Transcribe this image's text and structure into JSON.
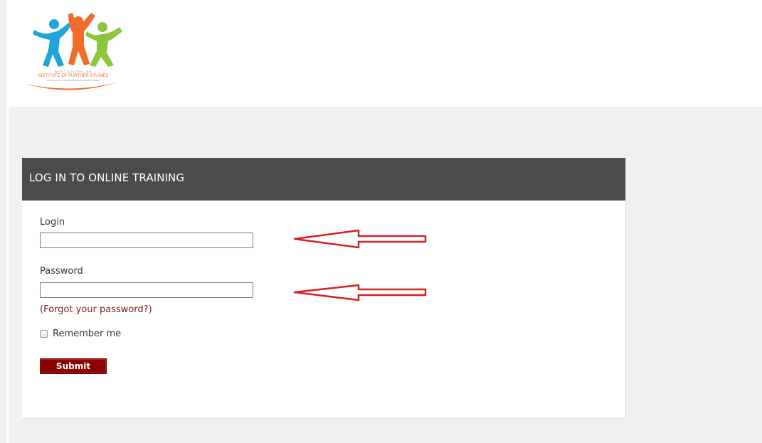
{
  "logo": {
    "alt": "West Australian Institute of Further Studies logo",
    "caption_line1": "WEST AUSTRALIAN",
    "caption_line2": "INSTITUTE OF FURTHER STUDIES",
    "caption_line3": "RTO Provider No: 45168 CRICOS Provider No: 03508A",
    "colors": [
      "#1fa5dc",
      "#ef6c2b",
      "#8cc63f"
    ]
  },
  "login_panel": {
    "title": "LOG IN TO ONLINE TRAINING",
    "login_label": "Login",
    "login_value": "",
    "password_label": "Password",
    "password_value": "",
    "forgot_link": "(Forgot your password?)",
    "remember_label": "Remember me",
    "remember_checked": false,
    "submit_label": "Submit"
  },
  "annotations": {
    "arrow_color": "#d42020",
    "arrows": [
      "pointing-to-login-field",
      "pointing-to-password-field"
    ]
  },
  "colors": {
    "header_bar": "#4b4b4b",
    "submit_bg": "#8b0000",
    "link": "#7b1c1c",
    "page_bg": "#f0f0f0"
  }
}
